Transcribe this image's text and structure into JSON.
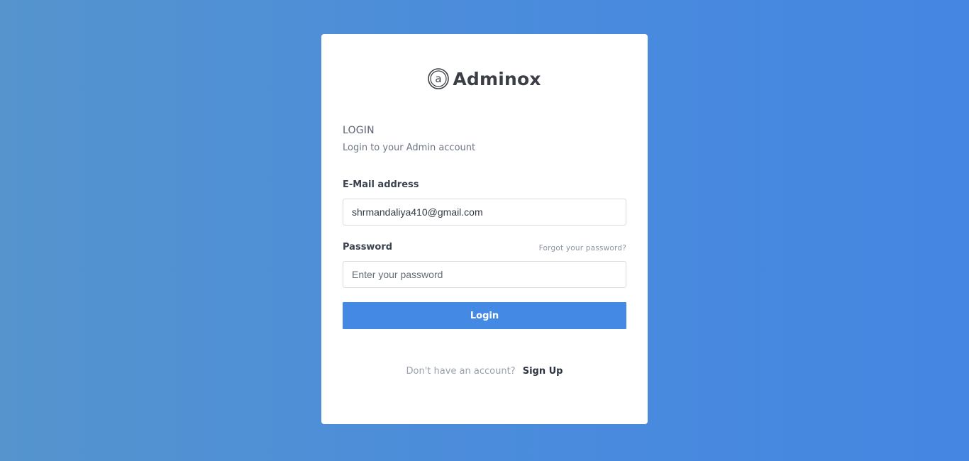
{
  "brand": {
    "name": "Adminox",
    "logo_icon": "circled-a-icon",
    "logo_letter": "a"
  },
  "login": {
    "title": "LOGIN",
    "subtitle": "Login to your Admin account"
  },
  "form": {
    "email_label": "E-Mail address",
    "email_value": "shrmandaliya410@gmail.com",
    "password_label": "Password",
    "password_placeholder": "Enter your password",
    "forgot_link": "Forgot your password?",
    "submit_label": "Login"
  },
  "signup": {
    "prompt": "Don't have an account?",
    "link": "Sign Up"
  },
  "colors": {
    "accent": "#4489e4",
    "background_left": "#5594cd",
    "background_right": "#4486e2",
    "card": "#ffffff"
  }
}
